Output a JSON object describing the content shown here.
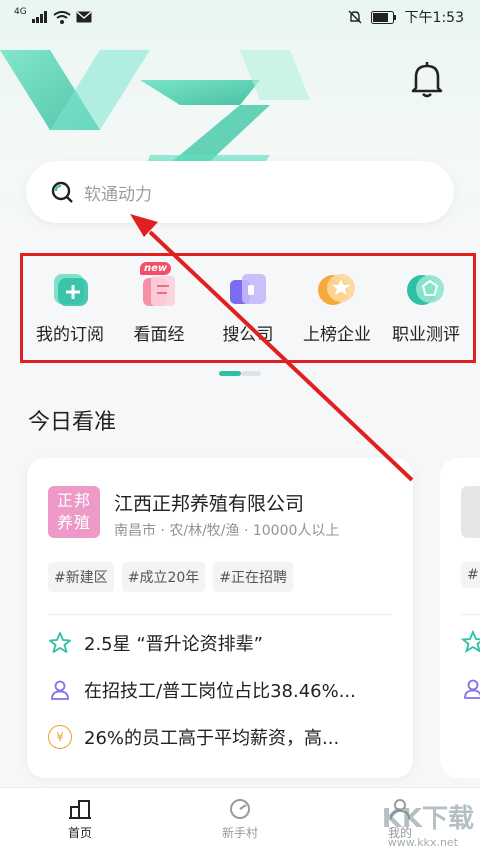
{
  "status_bar": {
    "network": "4G",
    "time": "下午1:53"
  },
  "search": {
    "placeholder": "软通动力"
  },
  "quick_menu": [
    {
      "label": "我的订阅",
      "icon": "subscribe-icon"
    },
    {
      "label": "看面经",
      "icon": "interview-notes-icon",
      "badge": "new"
    },
    {
      "label": "搜公司",
      "icon": "search-company-icon"
    },
    {
      "label": "上榜企业",
      "icon": "ranked-company-icon"
    },
    {
      "label": "职业测评",
      "icon": "career-test-icon"
    }
  ],
  "section": {
    "title": "今日看准"
  },
  "card": {
    "logo_text_1": "正邦",
    "logo_text_2": "养殖",
    "company_name": "江西正邦养殖有限公司",
    "meta": "南昌市 · 农/林/牧/渔 · 10000人以上",
    "tags": [
      "#新建区",
      "#成立20年",
      "#正在招聘"
    ],
    "facts": [
      {
        "icon": "star-icon",
        "text": "2.5星 “晋升论资排辈”"
      },
      {
        "icon": "person-icon",
        "text": "在招技工/普工岗位占比38.46%..."
      },
      {
        "icon": "salary-icon",
        "icon_char": "¥",
        "text": "26%的员工高于平均薪资，高..."
      }
    ]
  },
  "card2": {
    "tag_partial": "#"
  },
  "tabs": [
    {
      "label": "首页",
      "active": true
    },
    {
      "label": "新手村",
      "active": false
    },
    {
      "label": "我的",
      "active": false
    }
  ],
  "watermark": {
    "text": "KK下载",
    "url": "www.kkx.net"
  },
  "colors": {
    "accent": "#2ec0a4",
    "highlight_box": "#e02020"
  }
}
